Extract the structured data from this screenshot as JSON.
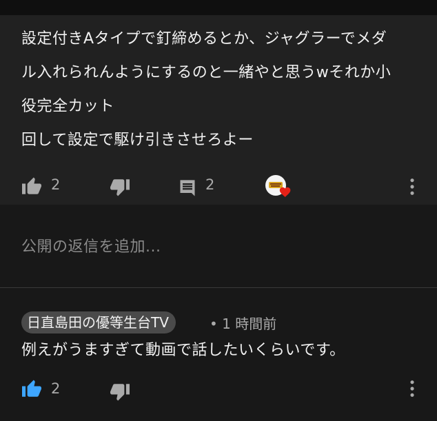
{
  "parent_comment": {
    "lines": [
      "設定付きAタイプで釘締めるとか、ジャグラーでメダ",
      "ル入れられんようにするのと一緒やと思うwそれか小",
      "役完全カット",
      "回して設定で駆け引きさせろよー"
    ],
    "like_count": "2",
    "reply_count": "2",
    "heart_icon": "creator-heart-icon",
    "colors": {
      "heart": "#e62117",
      "avatar_gold": "#d9a520"
    }
  },
  "reply_input": {
    "placeholder": "公開の返信を追加..."
  },
  "reply": {
    "author": "日直島田の優等生台TV",
    "time": "• 1 時間前",
    "text": "例えがうますぎて動画で話したいくらいです。",
    "like_count": "2",
    "colors": {
      "like_active": "#3ea6ff"
    }
  }
}
